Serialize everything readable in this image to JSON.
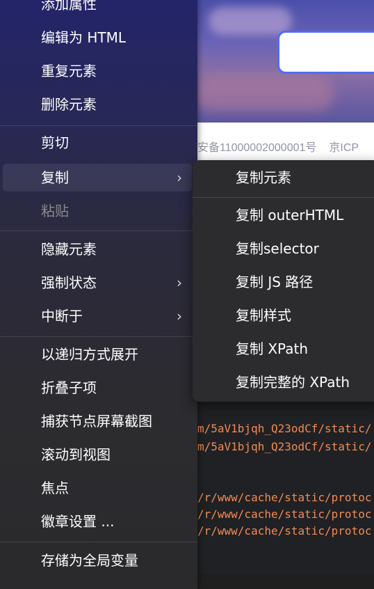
{
  "background_page": {
    "footer_texts": [
      "安备11000002000001号",
      "京ICP"
    ],
    "code_lines": [
      "m/5aV1bjqh_Q23odCf/static/",
      "m/5aV1bjqh_Q23odCf/static/",
      "/r/www/cache/static/protoc",
      "/r/www/cache/static/protoc",
      "/r/www/cache/static/protoc"
    ]
  },
  "context_menu": {
    "items": [
      {
        "label": "添加属性"
      },
      {
        "label": "编辑为 HTML"
      },
      {
        "label": "重复元素"
      },
      {
        "label": "删除元素"
      },
      {
        "label": "剪切"
      },
      {
        "label": "复制",
        "has_submenu": true
      },
      {
        "label": "粘贴",
        "disabled": true
      },
      {
        "label": "隐藏元素"
      },
      {
        "label": "强制状态",
        "has_submenu": true
      },
      {
        "label": "中断于",
        "has_submenu": true
      },
      {
        "label": "以递归方式展开"
      },
      {
        "label": "折叠子项"
      },
      {
        "label": "捕获节点屏幕截图"
      },
      {
        "label": "滚动到视图"
      },
      {
        "label": "焦点"
      },
      {
        "label": "徽章设置 ..."
      },
      {
        "label": "存储为全局变量"
      }
    ],
    "chevron": "›"
  },
  "copy_submenu": {
    "items": [
      {
        "label": "复制元素"
      },
      {
        "label": "复制 outerHTML"
      },
      {
        "label": "复制selector"
      },
      {
        "label": "复制 JS 路径"
      },
      {
        "label": "复制样式"
      },
      {
        "label": "复制 XPath"
      },
      {
        "label": "复制完整的 XPath"
      }
    ]
  },
  "colors": {
    "accent_border": "#4e6ef2",
    "code_text": "#f28b54",
    "menu_text": "#ffffff",
    "disabled_text": "#8a8a8a"
  }
}
